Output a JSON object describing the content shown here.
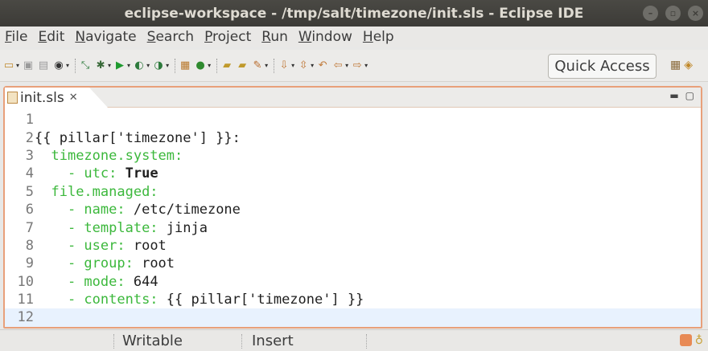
{
  "window": {
    "title": "eclipse-workspace - /tmp/salt/timezone/init.sls - Eclipse IDE",
    "controls": [
      "minimize-icon",
      "maximize-icon",
      "close-icon"
    ]
  },
  "menu": [
    {
      "u": "F",
      "rest": "ile"
    },
    {
      "u": "E",
      "rest": "dit"
    },
    {
      "u": "N",
      "rest": "avigate"
    },
    {
      "u": "S",
      "rest": "earch"
    },
    {
      "u": "P",
      "rest": "roject"
    },
    {
      "u": "R",
      "rest": "un"
    },
    {
      "u": "W",
      "rest": "indow"
    },
    {
      "u": "H",
      "rest": "elp"
    }
  ],
  "toolbar": {
    "quick_access": "Quick Access"
  },
  "editor": {
    "tab_label": "init.sls",
    "lines": [
      {
        "n": "1",
        "parts": []
      },
      {
        "n": "2",
        "parts": [
          {
            "c": "v",
            "t": "{{ pillar['timezone'] }}:"
          }
        ]
      },
      {
        "n": "3",
        "parts": [
          {
            "c": "v",
            "t": "  "
          },
          {
            "c": "k",
            "t": "timezone.system:"
          }
        ]
      },
      {
        "n": "4",
        "parts": [
          {
            "c": "v",
            "t": "    "
          },
          {
            "c": "k",
            "t": "- utc:"
          },
          {
            "c": "b",
            "t": " True"
          }
        ]
      },
      {
        "n": "5",
        "parts": [
          {
            "c": "v",
            "t": "  "
          },
          {
            "c": "k",
            "t": "file.managed:"
          }
        ]
      },
      {
        "n": "6",
        "parts": [
          {
            "c": "v",
            "t": "    "
          },
          {
            "c": "k",
            "t": "- name:"
          },
          {
            "c": "v",
            "t": " /etc/timezone"
          }
        ]
      },
      {
        "n": "7",
        "parts": [
          {
            "c": "v",
            "t": "    "
          },
          {
            "c": "k",
            "t": "- template:"
          },
          {
            "c": "v",
            "t": " jinja"
          }
        ]
      },
      {
        "n": "8",
        "parts": [
          {
            "c": "v",
            "t": "    "
          },
          {
            "c": "k",
            "t": "- user:"
          },
          {
            "c": "v",
            "t": " root"
          }
        ]
      },
      {
        "n": "9",
        "parts": [
          {
            "c": "v",
            "t": "    "
          },
          {
            "c": "k",
            "t": "- group:"
          },
          {
            "c": "v",
            "t": " root"
          }
        ]
      },
      {
        "n": "10",
        "parts": [
          {
            "c": "v",
            "t": "    "
          },
          {
            "c": "k",
            "t": "- mode:"
          },
          {
            "c": "v",
            "t": " 644"
          }
        ]
      },
      {
        "n": "11",
        "parts": [
          {
            "c": "v",
            "t": "    "
          },
          {
            "c": "k",
            "t": "- contents:"
          },
          {
            "c": "v",
            "t": " {{ pillar['timezone'] }}"
          }
        ]
      },
      {
        "n": "12",
        "parts": []
      }
    ],
    "highlight_line": "12"
  },
  "status": {
    "writable": "Writable",
    "insert_mode": "Insert"
  },
  "colors": {
    "key": "#3cb83c",
    "active_border": "#e8a07a",
    "current_line": "#e8f2fe"
  }
}
